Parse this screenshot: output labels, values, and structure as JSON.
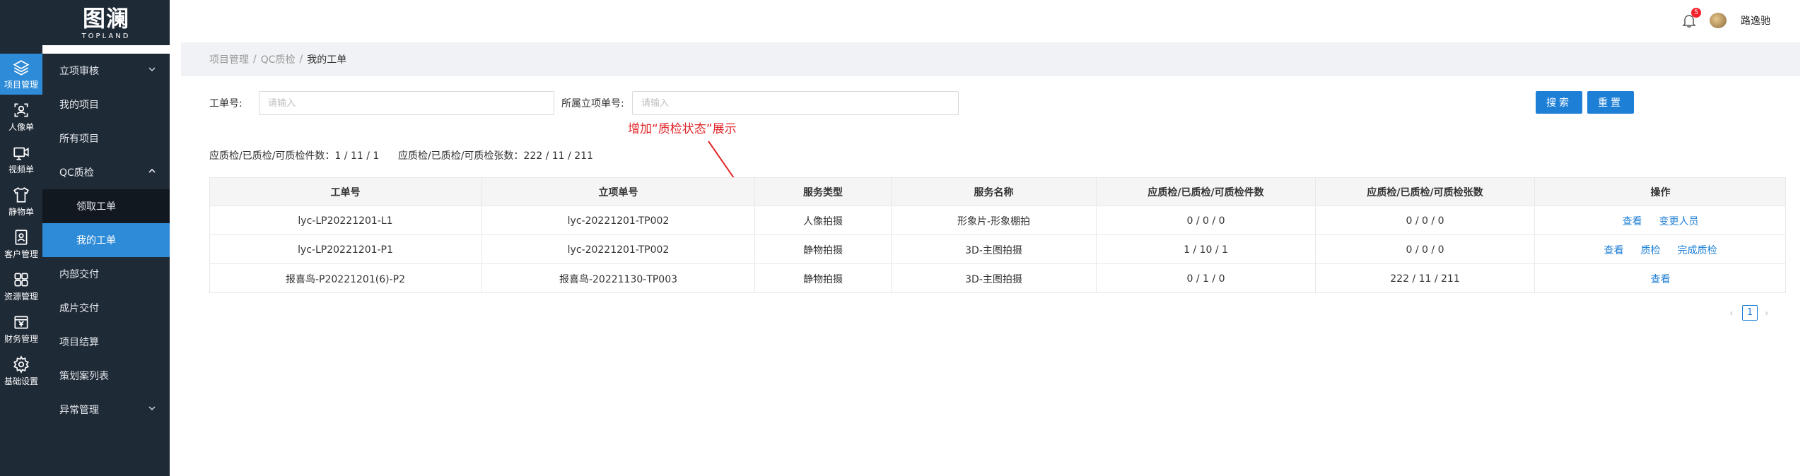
{
  "logo": {
    "mark": "图澜",
    "sub": "TOPLAND"
  },
  "rail": [
    {
      "label": "项目管理",
      "icon": "layers-icon",
      "active": true
    },
    {
      "label": "人像单",
      "icon": "face-scan-icon"
    },
    {
      "label": "视频单",
      "icon": "video-icon"
    },
    {
      "label": "静物单",
      "icon": "shirt-icon"
    },
    {
      "label": "客户管理",
      "icon": "contact-icon"
    },
    {
      "label": "资源管理",
      "icon": "grid-icon"
    },
    {
      "label": "财务管理",
      "icon": "yen-icon"
    },
    {
      "label": "基础设置",
      "icon": "gear-icon"
    }
  ],
  "menu": [
    {
      "label": "立项审核",
      "chevron": "down"
    },
    {
      "label": "我的项目"
    },
    {
      "label": "所有项目"
    },
    {
      "label": "QC质检",
      "chevron": "up"
    },
    {
      "label": "领取工单",
      "sub": true
    },
    {
      "label": "我的工单",
      "sub": true,
      "active": true
    },
    {
      "label": "内部交付"
    },
    {
      "label": "成片交付"
    },
    {
      "label": "项目结算"
    },
    {
      "label": "策划案列表"
    },
    {
      "label": "异常管理",
      "chevron": "down"
    }
  ],
  "header": {
    "notification_count": "5",
    "username": "路逸驰"
  },
  "breadcrumb": [
    "项目管理",
    "QC质检",
    "我的工单"
  ],
  "filters": {
    "order_no_label": "工单号:",
    "order_no_placeholder": "请输入",
    "project_no_label": "所属立项单号:",
    "project_no_placeholder": "请输入",
    "search_label": "搜索",
    "reset_label": "重置"
  },
  "annotation": "增加“质检状态”展示",
  "stats": {
    "items": "应质检/已质检/可质检件数：1 / 11 / 1",
    "sheets": "应质检/已质检/可质检张数：222 / 11 / 211"
  },
  "table": {
    "columns": [
      "工单号",
      "立项单号",
      "服务类型",
      "服务名称",
      "应质检/已质检/可质检件数",
      "应质检/已质检/可质检张数",
      "操作"
    ],
    "rows": [
      {
        "order": "lyc-LP20221201-L1",
        "project": "lyc-20221201-TP002",
        "type": "人像拍摄",
        "service": "形象片-形象棚拍",
        "items": "0 / 0 / 0",
        "sheets": "0 / 0 / 0",
        "actions": [
          "查看",
          "变更人员"
        ]
      },
      {
        "order": "lyc-LP20221201-P1",
        "project": "lyc-20221201-TP002",
        "type": "静物拍摄",
        "service": "3D-主图拍摄",
        "items": "1 / 10 / 1",
        "sheets": "0 / 0 / 0",
        "actions": [
          "查看",
          "质检",
          "完成质检"
        ]
      },
      {
        "order": "报喜鸟-P20221201(6)-P2",
        "project": "报喜鸟-20221130-TP003",
        "type": "静物拍摄",
        "service": "3D-主图拍摄",
        "items": "0 / 1 / 0",
        "sheets": "222 / 11 / 211",
        "actions": [
          "查看"
        ]
      }
    ]
  },
  "pagination": {
    "current": "1",
    "prev": "‹",
    "next": "›"
  }
}
